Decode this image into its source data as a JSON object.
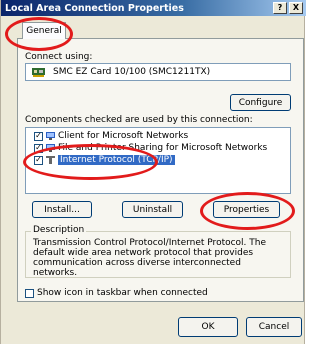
{
  "window": {
    "title": "Local Area Connection Properties",
    "help_label": "?",
    "close_label": "X"
  },
  "tabs": [
    {
      "label": "General"
    }
  ],
  "general": {
    "connect_using_label": "Connect using:",
    "adapter_name": "SMC EZ Card 10/100 (SMC1211TX)",
    "configure_label": "Configure",
    "components_label": "Components checked are used by this connection:",
    "components": [
      {
        "label": "Client for Microsoft Networks",
        "checked": true,
        "icon": "network-client-icon"
      },
      {
        "label": "File and Printer Sharing for Microsoft Networks",
        "checked": true,
        "icon": "file-printer-sharing-icon"
      },
      {
        "label": "Internet Protocol (TCP/IP)",
        "checked": true,
        "icon": "protocol-icon",
        "selected": true
      }
    ],
    "install_label": "Install...",
    "uninstall_label": "Uninstall",
    "properties_label": "Properties",
    "description_title": "Description",
    "description_text": "Transmission Control Protocol/Internet Protocol. The default wide area network protocol that provides communication across diverse interconnected networks.",
    "show_icon_label": "Show icon in taskbar when connected",
    "show_icon_checked": false
  },
  "footer": {
    "ok_label": "OK",
    "cancel_label": "Cancel"
  },
  "colors": {
    "annotation": "#e21b1b",
    "selection": "#316ac5"
  }
}
